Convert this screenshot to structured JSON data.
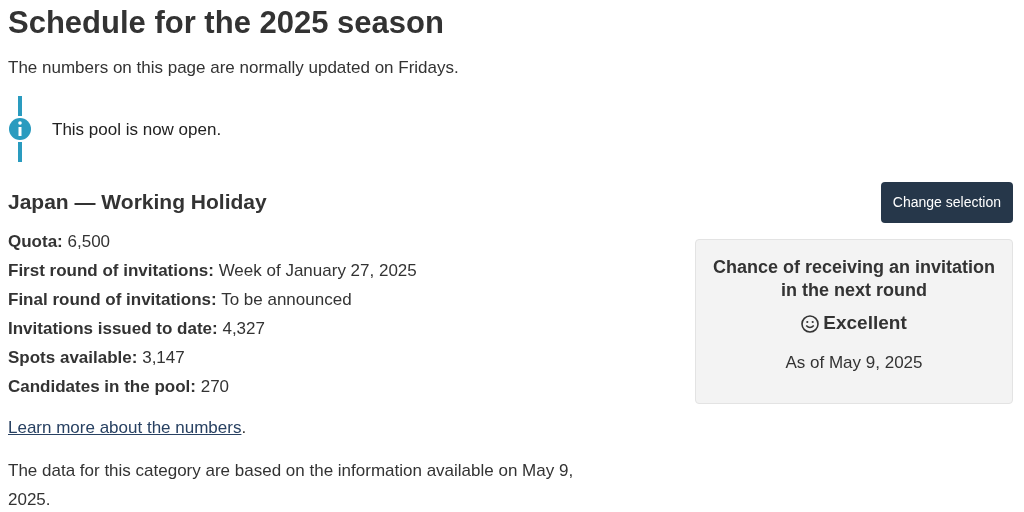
{
  "title": "Schedule for the 2025 season",
  "subtitle": "The numbers on this page are normally updated on Fridays.",
  "notice": {
    "text": "This pool is now open."
  },
  "category": {
    "heading": "Japan — Working Holiday",
    "button": "Change selection"
  },
  "facts": [
    {
      "label": "Quota:",
      "value": "6,500"
    },
    {
      "label": "First round of invitations:",
      "value": "Week of January 27, 2025"
    },
    {
      "label": "Final round of invitations:",
      "value": "To be announced"
    },
    {
      "label": "Invitations issued to date:",
      "value": "4,327"
    },
    {
      "label": "Spots available:",
      "value": "3,147"
    },
    {
      "label": "Candidates in the pool:",
      "value": "270"
    }
  ],
  "more_link": {
    "link": "Learn more about the numbers",
    "after": "."
  },
  "footnote": "The data for this category are based on the information available on May 9, 2025.",
  "chance_card": {
    "title": "Chance of receiving an invitation in the next round",
    "rating": "Excellent",
    "date": "As of May 9, 2025"
  }
}
